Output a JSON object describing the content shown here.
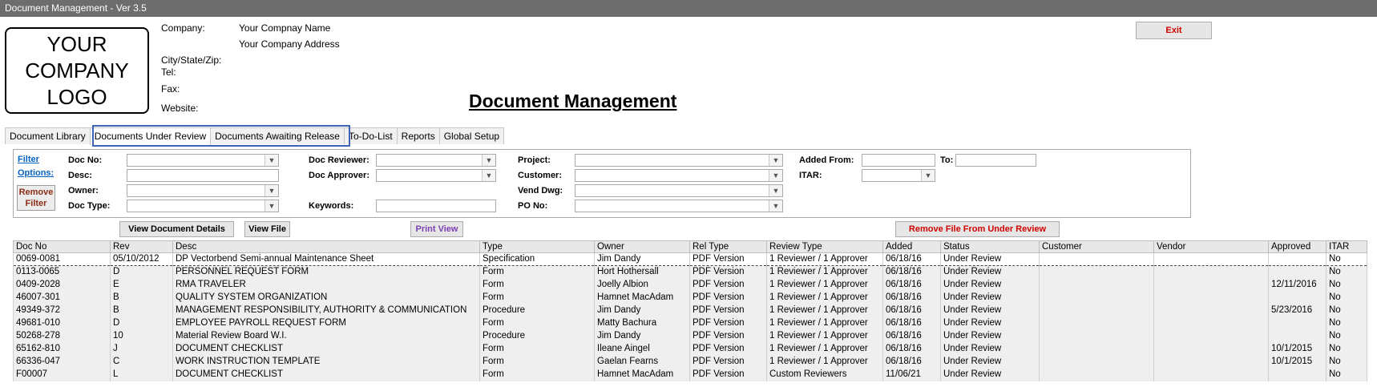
{
  "window": {
    "title": "Document Management - Ver 3.5"
  },
  "logo": {
    "text": "YOUR\nCOMPANY\nLOGO"
  },
  "company": {
    "company_label": "Company:",
    "company_name": "Your Compnay Name",
    "company_address": "Your Company Address",
    "city_label": "City/State/Zip:",
    "tel_label": "Tel:",
    "fax_label": "Fax:",
    "website_label": "Website:"
  },
  "header": {
    "title": "Document Management",
    "exit_label": "Exit"
  },
  "tabs": [
    {
      "label": "Document Library"
    },
    {
      "label": "Documents Under Review"
    },
    {
      "label": "Documents Awaiting Release"
    },
    {
      "label": "To-Do-List"
    },
    {
      "label": "Reports"
    },
    {
      "label": "Global Setup"
    }
  ],
  "filter": {
    "options_link": "Filter Options:",
    "remove_label": "Remove Filter",
    "doc_no": "Doc No:",
    "desc": "Desc:",
    "owner": "Owner:",
    "doc_type": "Doc Type:",
    "doc_reviewer": "Doc Reviewer:",
    "doc_approver": "Doc Approver:",
    "keywords": "Keywords:",
    "project": "Project:",
    "customer": "Customer:",
    "vend_dwg": "Vend Dwg:",
    "po_no": "PO No:",
    "added_from": "Added From:",
    "to": "To:",
    "itar": "ITAR:"
  },
  "actions": {
    "view_details": "View Document Details",
    "view_file": "View File",
    "print_view": "Print View",
    "remove_review": "Remove File From Under Review"
  },
  "icons": {
    "dropdown": "dropdown-arrow-icon"
  },
  "colors": {
    "exit_text": "#d00000",
    "link": "#0563c1",
    "print_text": "#7c3fb2",
    "tab_highlight": "#3c63b4",
    "titlebar": "#6d6d6d"
  },
  "table": {
    "columns": [
      "Doc No",
      "Rev",
      "Desc",
      "Type",
      "Owner",
      "Rel Type",
      "Review Type",
      "Added",
      "Status",
      "Customer",
      "Vendor",
      "Approved",
      "ITAR"
    ],
    "rows": [
      [
        "0069-0081",
        "05/10/2012",
        "DP Vectorbend Semi-annual Maintenance Sheet",
        "Specification",
        "Jim Dandy",
        "PDF Version",
        "1 Reviewer / 1 Approver",
        "06/18/16",
        "Under Review",
        "",
        "",
        "",
        "No"
      ],
      [
        "0113-0065",
        "D",
        "PERSONNEL REQUEST FORM",
        "Form",
        "Hort Hothersall",
        "PDF Version",
        "1 Reviewer / 1 Approver",
        "06/18/16",
        "Under Review",
        "",
        "",
        "",
        "No"
      ],
      [
        "0409-2028",
        "E",
        "RMA TRAVELER",
        "Form",
        "Joelly Albion",
        "PDF Version",
        "1 Reviewer / 1 Approver",
        "06/18/16",
        "Under Review",
        "",
        "",
        "12/11/2016",
        "No"
      ],
      [
        "46007-301",
        "B",
        "QUALITY SYSTEM ORGANIZATION",
        "Form",
        "Hamnet MacAdam",
        "PDF Version",
        "1 Reviewer / 1 Approver",
        "06/18/16",
        "Under Review",
        "",
        "",
        "",
        "No"
      ],
      [
        "49349-372",
        "B",
        "MANAGEMENT RESPONSIBILITY, AUTHORITY & COMMUNICATION",
        "Procedure",
        "Jim Dandy",
        "PDF Version",
        "1 Reviewer / 1 Approver",
        "06/18/16",
        "Under Review",
        "",
        "",
        "5/23/2016",
        "No"
      ],
      [
        "49681-010",
        "D",
        "EMPLOYEE PAYROLL REQUEST FORM",
        "Form",
        "Matty Bachura",
        "PDF Version",
        "1 Reviewer / 1 Approver",
        "06/18/16",
        "Under Review",
        "",
        "",
        "",
        "No"
      ],
      [
        "50268-278",
        "10",
        "Material Review Board W.I.",
        "Procedure",
        "Jim Dandy",
        "PDF Version",
        "1 Reviewer / 1 Approver",
        "06/18/16",
        "Under Review",
        "",
        "",
        "",
        "No"
      ],
      [
        "65162-810",
        "J",
        "DOCUMENT CHECKLIST",
        "Form",
        "Ileane Aingel",
        "PDF Version",
        "1 Reviewer / 1 Approver",
        "06/18/16",
        "Under Review",
        "",
        "",
        "10/1/2015",
        "No"
      ],
      [
        "66336-047",
        "C",
        "WORK INSTRUCTION TEMPLATE",
        "Form",
        "Gaelan Fearns",
        "PDF Version",
        "1 Reviewer / 1 Approver",
        "06/18/16",
        "Under Review",
        "",
        "",
        "10/1/2015",
        "No"
      ],
      [
        "F00007",
        "L",
        "DOCUMENT CHECKLIST",
        "Form",
        "Hamnet MacAdam",
        "PDF Version",
        "Custom Reviewers",
        "11/06/21",
        "Under Review",
        "",
        "",
        "",
        "No"
      ]
    ]
  }
}
